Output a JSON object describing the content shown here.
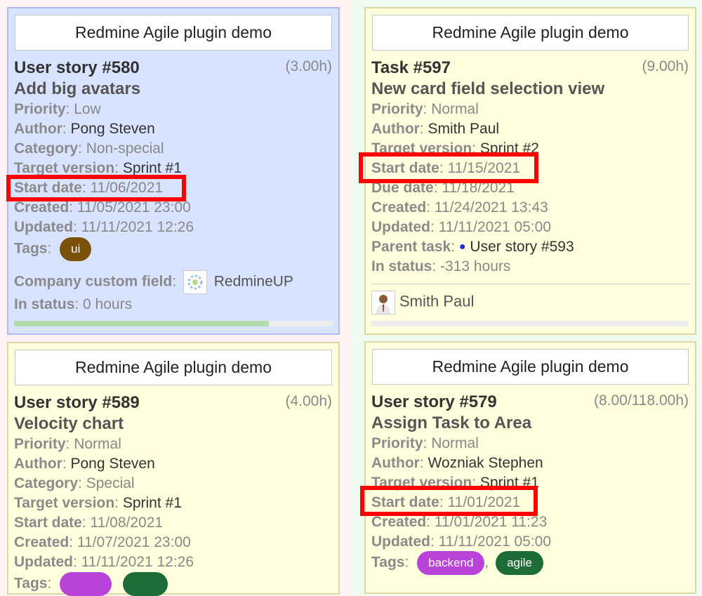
{
  "cards": [
    {
      "project": "Redmine Agile plugin demo",
      "title": "User story #580",
      "hours": "(3.00h)",
      "subject": "Add big avatars",
      "fields": [
        {
          "label": "Priority",
          "value": "Low"
        },
        {
          "label": "Author",
          "value": "Pong Steven"
        },
        {
          "label": "Category",
          "value": "Non-special"
        },
        {
          "label": "Target version",
          "value": "Sprint #1"
        },
        {
          "label": "Start date",
          "value": "11/06/2021"
        },
        {
          "label": "Created",
          "value": "11/05/2021 23:00"
        },
        {
          "label": "Updated",
          "value": "11/11/2021 12:26"
        }
      ],
      "tags_label": "Tags",
      "tags": [
        {
          "name": "ui",
          "color": "#7a5108"
        }
      ],
      "custom_field": {
        "label": "Company custom field",
        "value": "RedmineUP"
      },
      "in_status": {
        "label": "In status",
        "value": "0 hours"
      },
      "progress": 0.8
    },
    {
      "project": "Redmine Agile plugin demo",
      "title": "Task #597",
      "hours": "(9.00h)",
      "subject": "New card field selection view",
      "fields": [
        {
          "label": "Priority",
          "value": "Normal"
        },
        {
          "label": "Author",
          "value": "Smith Paul"
        },
        {
          "label": "Target version",
          "value": "Sprint #2"
        },
        {
          "label": "Start date",
          "value": "11/15/2021"
        },
        {
          "label": "Due date",
          "value": "11/18/2021"
        },
        {
          "label": "Created",
          "value": "11/24/2021 13:43"
        },
        {
          "label": "Updated",
          "value": "11/11/2021 05:00"
        }
      ],
      "parent": {
        "label": "Parent task",
        "value": "User story #593"
      },
      "in_status": {
        "label": "In status",
        "value": "-313 hours"
      },
      "assignee": "Smith Paul",
      "progress": 0
    },
    {
      "project": "Redmine Agile plugin demo",
      "title": "User story #589",
      "hours": "(4.00h)",
      "subject": "Velocity chart",
      "fields": [
        {
          "label": "Priority",
          "value": "Normal"
        },
        {
          "label": "Author",
          "value": "Pong Steven"
        },
        {
          "label": "Category",
          "value": "Special"
        },
        {
          "label": "Target version",
          "value": "Sprint #1"
        },
        {
          "label": "Start date",
          "value": "11/08/2021"
        },
        {
          "label": "Created",
          "value": "11/07/2021 23:00"
        },
        {
          "label": "Updated",
          "value": "11/11/2021 12:26"
        }
      ],
      "tags_label": "Tags"
    },
    {
      "project": "Redmine Agile plugin demo",
      "title": "User story #579",
      "hours": "(8.00/118.00h)",
      "subject": "Assign Task to Area",
      "fields": [
        {
          "label": "Priority",
          "value": "Normal"
        },
        {
          "label": "Author",
          "value": "Wozniak Stephen"
        },
        {
          "label": "Target version",
          "value": "Sprint #1"
        },
        {
          "label": "Start date",
          "value": "11/01/2021"
        },
        {
          "label": "Created",
          "value": "11/01/2021 11:23"
        },
        {
          "label": "Updated",
          "value": "11/11/2021 05:00"
        }
      ],
      "tags_label": "Tags",
      "tags": [
        {
          "name": "backend",
          "color": "#b943d8"
        },
        {
          "name": "agile",
          "color": "#1d6b36"
        }
      ]
    }
  ],
  "highlight_color": "#ff0000"
}
